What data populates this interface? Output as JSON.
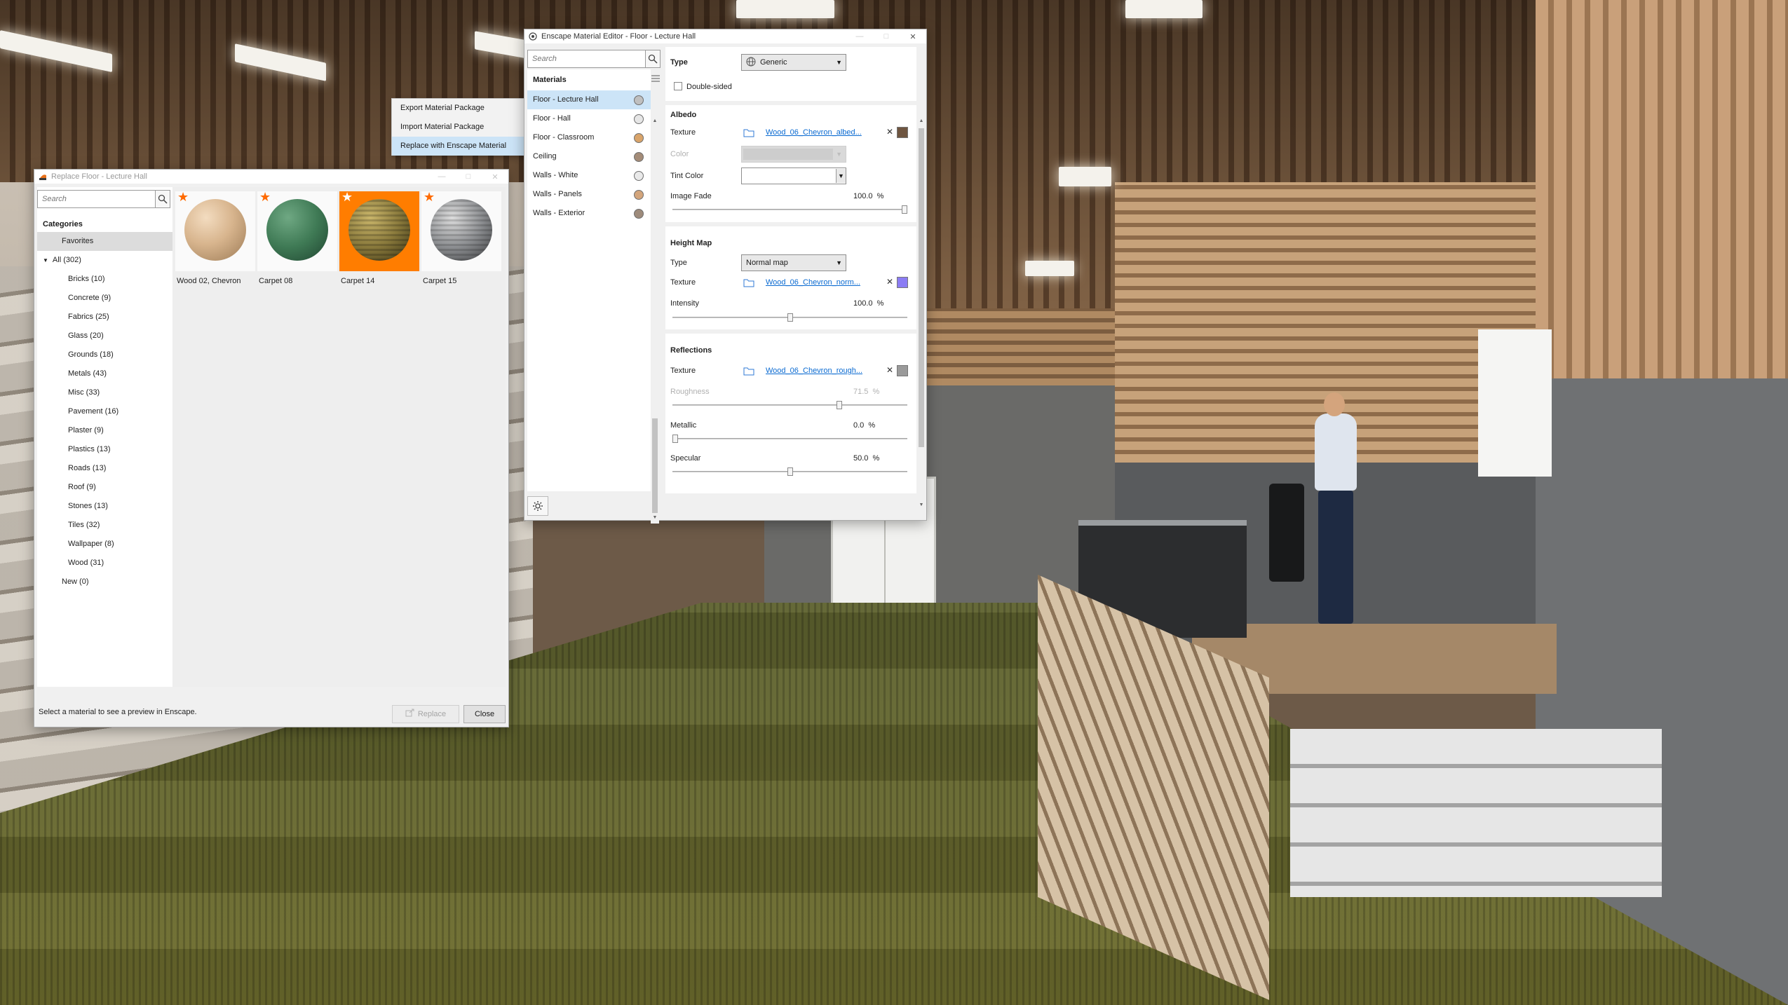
{
  "replace_window": {
    "title": "Replace Floor - Lecture Hall",
    "search_placeholder": "Search",
    "categories_heading": "Categories",
    "categories": [
      {
        "label": "Favorites",
        "selected": true,
        "indent": 1
      },
      {
        "label": "All (302)",
        "selected": false,
        "indent": 0,
        "expanded": true
      },
      {
        "label": "Bricks (10)",
        "indent": 2
      },
      {
        "label": "Concrete (9)",
        "indent": 2
      },
      {
        "label": "Fabrics (25)",
        "indent": 2
      },
      {
        "label": "Glass (20)",
        "indent": 2
      },
      {
        "label": "Grounds (18)",
        "indent": 2
      },
      {
        "label": "Metals (43)",
        "indent": 2
      },
      {
        "label": "Misc (33)",
        "indent": 2
      },
      {
        "label": "Pavement (16)",
        "indent": 2
      },
      {
        "label": "Plaster (9)",
        "indent": 2
      },
      {
        "label": "Plastics (13)",
        "indent": 2
      },
      {
        "label": "Roads (13)",
        "indent": 2
      },
      {
        "label": "Roof (9)",
        "indent": 2
      },
      {
        "label": "Stones (13)",
        "indent": 2
      },
      {
        "label": "Tiles (32)",
        "indent": 2
      },
      {
        "label": "Wallpaper (8)",
        "indent": 2
      },
      {
        "label": "Wood (31)",
        "indent": 2
      },
      {
        "label": "New (0)",
        "indent": 1
      }
    ],
    "materials": [
      {
        "label": "Wood 02, Chevron",
        "selected": false,
        "color": "#d8b58e"
      },
      {
        "label": "Carpet 08",
        "selected": false,
        "color": "#3f7a55"
      },
      {
        "label": "Carpet 14",
        "selected": true,
        "color": "#8a7a3c"
      },
      {
        "label": "Carpet 15",
        "selected": false,
        "color": "#8d8f92"
      }
    ],
    "status_text": "Select a material to see a preview in Enscape.",
    "replace_label": "Replace",
    "close_label": "Close"
  },
  "context_menu": {
    "items": [
      {
        "label": "Export Material Package",
        "highlighted": false
      },
      {
        "label": "Import Material Package",
        "highlighted": false
      },
      {
        "label": "Replace with Enscape Material",
        "highlighted": true
      }
    ]
  },
  "editor_window": {
    "title": "Enscape Material Editor - Floor - Lecture Hall",
    "search_placeholder": "Search",
    "materials_heading": "Materials",
    "materials": [
      {
        "label": "Floor - Lecture Hall",
        "selected": true,
        "swatch": "#bfbfbf"
      },
      {
        "label": "Floor - Hall",
        "selected": false,
        "swatch": "#e6e6e6"
      },
      {
        "label": "Floor - Classroom",
        "selected": false,
        "swatch": "#d9a46a"
      },
      {
        "label": "Ceiling",
        "selected": false,
        "swatch": "#a48c78"
      },
      {
        "label": "Walls - White",
        "selected": false,
        "swatch": "#e9e9e9"
      },
      {
        "label": "Walls - Panels",
        "selected": false,
        "swatch": "#d3a57c"
      },
      {
        "label": "Walls - Exterior",
        "selected": false,
        "swatch": "#9e8b7b"
      }
    ],
    "type_label": "Type",
    "type_value": "Generic",
    "double_sided_label": "Double-sided",
    "double_sided_checked": false,
    "albedo": {
      "heading": "Albedo",
      "texture_label": "Texture",
      "texture_file": "Wood_06_Chevron_albed...",
      "texture_swatch": "#6e5540",
      "color_label": "Color",
      "tint_label": "Tint Color",
      "image_fade_label": "Image Fade",
      "image_fade_value": "100.0",
      "image_fade_unit": "%",
      "image_fade_level": 1.0
    },
    "height_map": {
      "heading": "Height Map",
      "type_label": "Type",
      "type_value": "Normal map",
      "texture_label": "Texture",
      "texture_file": "Wood_06_Chevron_norm...",
      "texture_swatch": "#8b7cf4",
      "intensity_label": "Intensity",
      "intensity_value": "100.0",
      "intensity_unit": "%",
      "intensity_level": 0.5
    },
    "reflections": {
      "heading": "Reflections",
      "texture_label": "Texture",
      "texture_file": "Wood_06_Chevron_rough...",
      "texture_swatch": "#9a9a9a",
      "roughness_label": "Roughness",
      "roughness_value": "71.5",
      "roughness_unit": "%",
      "roughness_level": 0.715,
      "metallic_label": "Metallic",
      "metallic_value": "0.0",
      "metallic_unit": "%",
      "metallic_level": 0.0,
      "specular_label": "Specular",
      "specular_value": "50.0",
      "specular_unit": "%",
      "specular_level": 0.5
    }
  }
}
